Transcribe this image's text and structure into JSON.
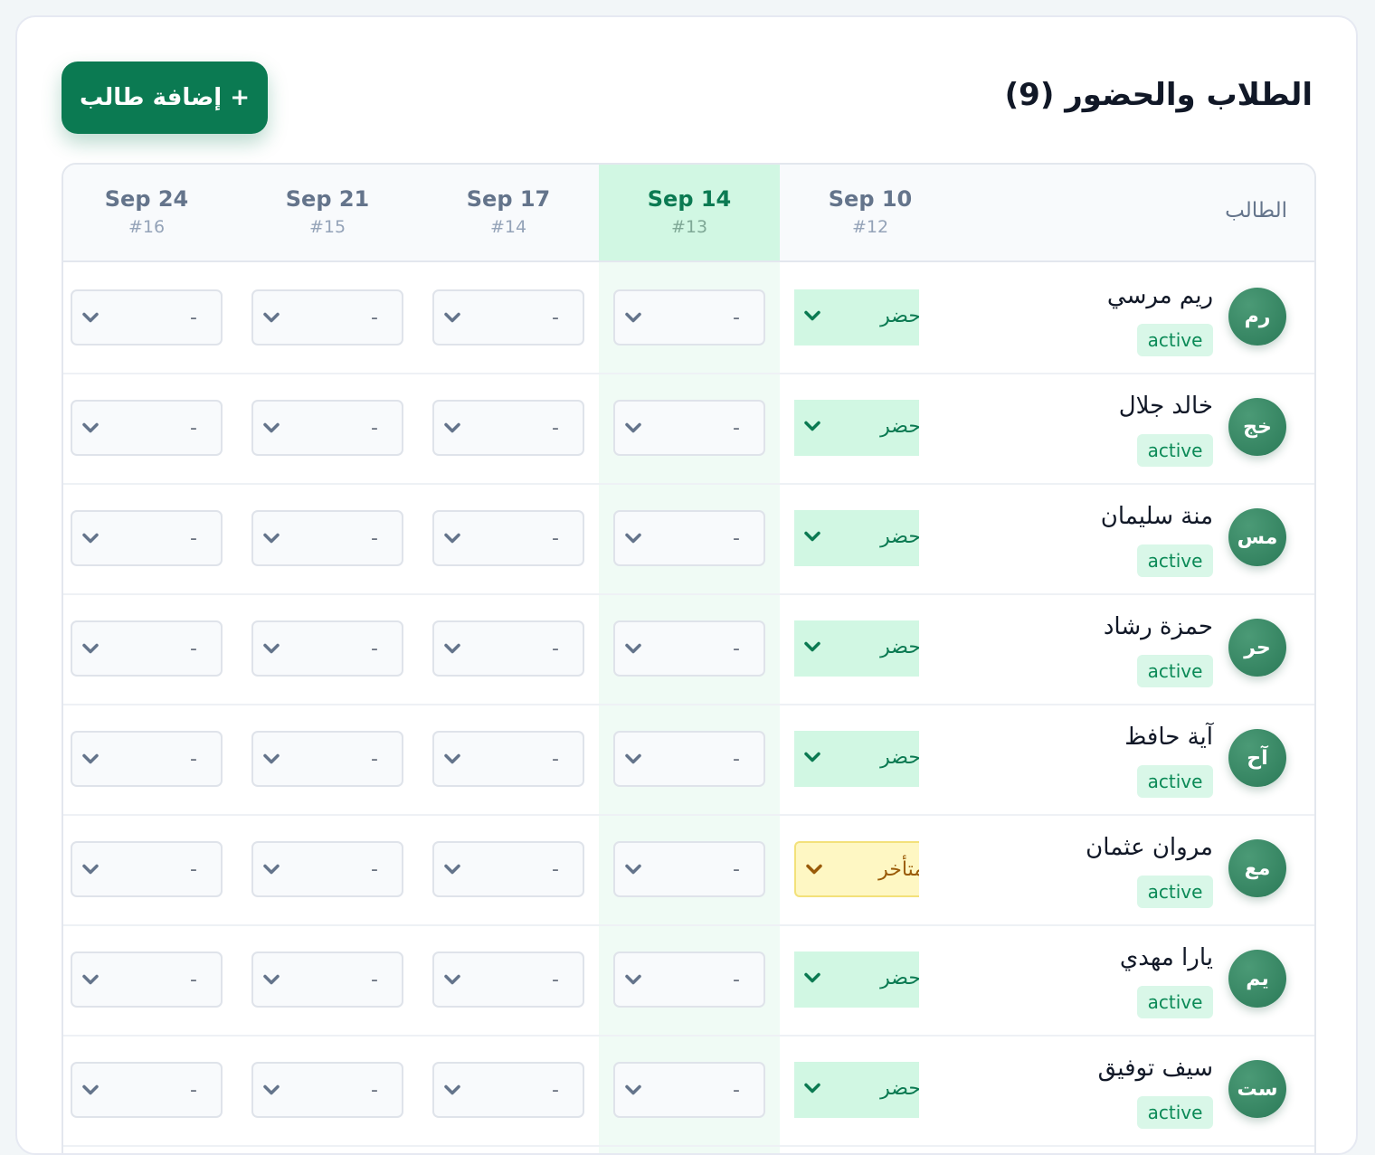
{
  "header": {
    "title": "الطلاب والحضور (9)",
    "add_button_label": "+ إضافة طالب"
  },
  "table": {
    "student_column_label": "الطالب",
    "sessions": [
      {
        "date": "Sep 10",
        "number": "#12"
      },
      {
        "date": "Sep 14",
        "number": "#13"
      },
      {
        "date": "Sep 17",
        "number": "#14"
      },
      {
        "date": "Sep 21",
        "number": "#15"
      },
      {
        "date": "Sep 24",
        "number": "#16"
      }
    ],
    "highlighted_session_index": 1,
    "students": [
      {
        "initials": "رم",
        "name": "ريم مرسي",
        "status": "active",
        "attendance": [
          "حضر",
          "-",
          "-",
          "-",
          "-"
        ]
      },
      {
        "initials": "خج",
        "name": "خالد جلال",
        "status": "active",
        "attendance": [
          "حضر",
          "-",
          "-",
          "-",
          "-"
        ]
      },
      {
        "initials": "مس",
        "name": "منة سليمان",
        "status": "active",
        "attendance": [
          "حضر",
          "-",
          "-",
          "-",
          "-"
        ]
      },
      {
        "initials": "حر",
        "name": "حمزة رشاد",
        "status": "active",
        "attendance": [
          "حضر",
          "-",
          "-",
          "-",
          "-"
        ]
      },
      {
        "initials": "آح",
        "name": "آية حافظ",
        "status": "active",
        "attendance": [
          "حضر",
          "-",
          "-",
          "-",
          "-"
        ]
      },
      {
        "initials": "مع",
        "name": "مروان عثمان",
        "status": "active",
        "attendance": [
          "متأخر",
          "-",
          "-",
          "-",
          "-"
        ]
      },
      {
        "initials": "يم",
        "name": "يارا مهدي",
        "status": "active",
        "attendance": [
          "حضر",
          "-",
          "-",
          "-",
          "-"
        ]
      },
      {
        "initials": "ست",
        "name": "سيف توفيق",
        "status": "active",
        "attendance": [
          "حضر",
          "-",
          "-",
          "-",
          "-"
        ]
      }
    ]
  },
  "colors": {
    "accent": "#0b7a52",
    "present_bg": "#d1f7e3",
    "late_bg": "#fef7c3",
    "late_text": "#9a5b08",
    "highlight_column": "#f0fbf5"
  },
  "icons": {
    "dropdown": "chevron-down-icon"
  }
}
